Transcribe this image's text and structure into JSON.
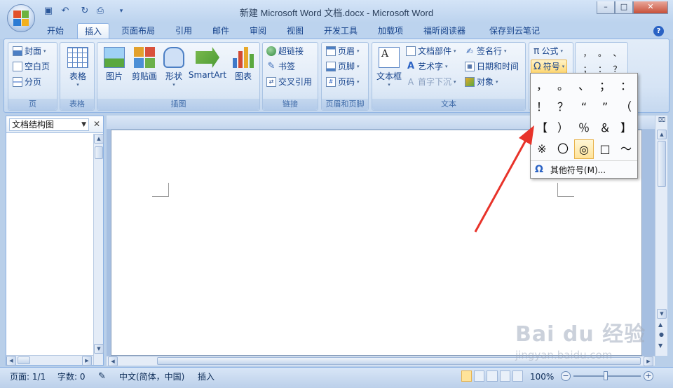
{
  "window": {
    "title": "新建 Microsoft Word 文档.docx - Microsoft Word",
    "controls": [
      "–",
      "□",
      "✕"
    ]
  },
  "quick_access": [
    "save-icon",
    "undo-icon",
    "redo-icon",
    "print-preview-icon",
    "customize-icon"
  ],
  "tabs": [
    {
      "label": "开始",
      "active": false
    },
    {
      "label": "插入",
      "active": true
    },
    {
      "label": "页面布局",
      "active": false
    },
    {
      "label": "引用",
      "active": false
    },
    {
      "label": "邮件",
      "active": false
    },
    {
      "label": "审阅",
      "active": false
    },
    {
      "label": "视图",
      "active": false
    },
    {
      "label": "开发工具",
      "active": false
    },
    {
      "label": "加载项",
      "active": false
    },
    {
      "label": "福昕阅读器",
      "active": false
    },
    {
      "label": "保存到云笔记",
      "active": false
    }
  ],
  "ribbon": {
    "pages": {
      "label": "页",
      "items": [
        "封面",
        "空白页",
        "分页"
      ]
    },
    "tables": {
      "label": "表格",
      "items": [
        "表格"
      ]
    },
    "illustrations": {
      "label": "插图",
      "items": [
        "图片",
        "剪贴画",
        "形状",
        "SmartArt",
        "图表"
      ]
    },
    "links": {
      "label": "链接",
      "items": [
        "超链接",
        "书签",
        "交叉引用"
      ]
    },
    "header_footer": {
      "label": "页眉和页脚",
      "items": [
        "页眉",
        "页脚",
        "页码"
      ]
    },
    "text": {
      "label": "文本",
      "textbox": "文本框",
      "items": [
        "文档部件",
        "艺术字",
        "首字下沉",
        "签名行",
        "日期和时间",
        "对象"
      ]
    },
    "symbols": {
      "formula": "公式",
      "symbol": "符号",
      "quick": [
        "，",
        "。",
        "、",
        "；",
        "：",
        "？"
      ]
    }
  },
  "nav_pane": {
    "title": "文档结构图",
    "close": "✕"
  },
  "symbol_panel": {
    "rows": [
      [
        "，",
        "。",
        "、",
        "；",
        "："
      ],
      [
        "！",
        "？",
        "“",
        "”",
        "（"
      ],
      [
        "【",
        "）",
        "％",
        "＆",
        "】"
      ],
      [
        "※",
        "〇",
        "◎",
        "□",
        "～"
      ]
    ],
    "selected": "◎",
    "more_label": "其他符号(M)..."
  },
  "status": {
    "page": "页面: 1/1",
    "words": "字数: 0",
    "language": "中文(简体，中国)",
    "mode": "插入",
    "zoom": "100%"
  },
  "watermark": {
    "brand": "Bai du 经验",
    "url": "jingyan.baidu.com"
  },
  "colors": {
    "accent": "#15428b",
    "ribbon_bg": "#dbe7f6",
    "arrow": "#e8332a"
  }
}
